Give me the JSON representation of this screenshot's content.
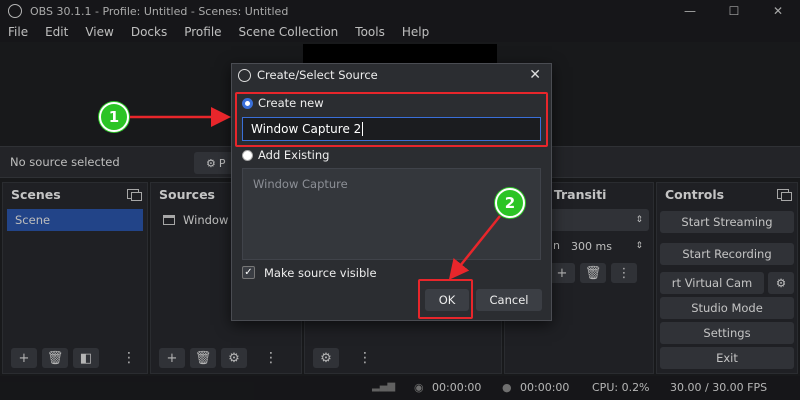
{
  "window": {
    "title": "OBS 30.1.1 - Profile: Untitled - Scenes: Untitled",
    "minimize": "—",
    "maximize": "☐",
    "close": "✕"
  },
  "menu": [
    "File",
    "Edit",
    "View",
    "Docks",
    "Profile",
    "Scene Collection",
    "Tools",
    "Help"
  ],
  "source_toolbar": {
    "no_source": "No source selected",
    "properties_partial": "P"
  },
  "scenes": {
    "title": "Scenes",
    "items": [
      "Scene"
    ]
  },
  "sources": {
    "title": "Sources",
    "items": [
      "Window"
    ]
  },
  "transitions": {
    "title_partial": "e Transiti",
    "duration_label_partial": "n",
    "duration": "300 ms"
  },
  "controls": {
    "title": "Controls",
    "start_streaming": "Start Streaming",
    "start_recording": "Start Recording",
    "virtual_cam_partial": "rt Virtual Cam",
    "studio_mode": "Studio Mode",
    "settings": "Settings",
    "exit": "Exit"
  },
  "status": {
    "stream_time": "00:00:00",
    "record_time": "00:00:00",
    "cpu": "CPU: 0.2%",
    "fps": "30.00 / 30.00 FPS"
  },
  "dialog": {
    "title": "Create/Select Source",
    "close": "✕",
    "create_new": "Create new",
    "name_value": "Window Capture 2",
    "add_existing": "Add Existing",
    "existing_items": [
      "Window Capture"
    ],
    "make_visible": "Make source visible",
    "ok": "OK",
    "cancel": "Cancel"
  },
  "annotations": {
    "step1": "1",
    "step2": "2",
    "color": "#e8262b",
    "badge_color": "#2bc425"
  }
}
